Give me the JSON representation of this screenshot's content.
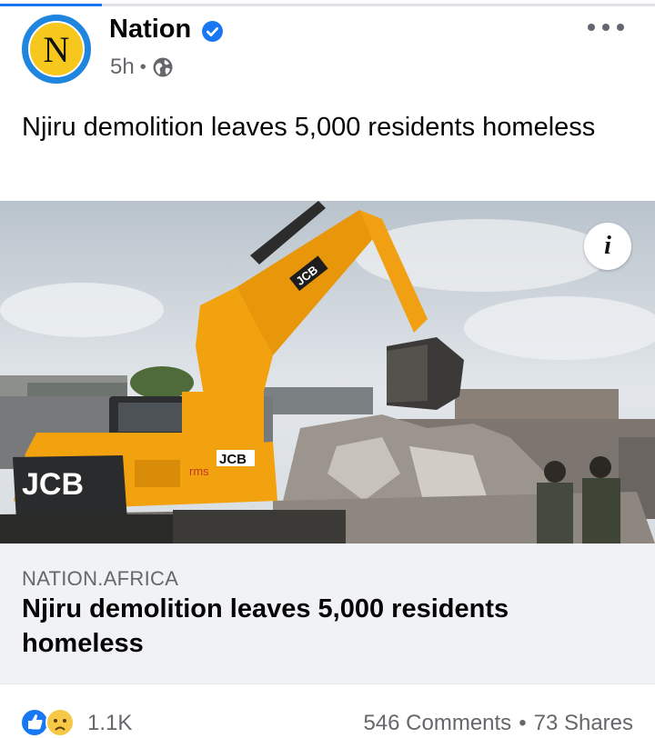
{
  "post": {
    "page_name": "Nation",
    "avatar_letter": "N",
    "timestamp": "5h",
    "separator": "•",
    "caption": "Njiru demolition leaves 5,000 residents homeless",
    "verified_icon": "verified-badge-icon",
    "privacy_icon": "globe-icon",
    "more_icon": "more-options-icon"
  },
  "media": {
    "info_label": "i",
    "excavator_brand": "JCB",
    "excavator_logo": "rms"
  },
  "link_preview": {
    "domain": "NATION.AFRICA",
    "title": "Njiru demolition leaves 5,000 residents homeless"
  },
  "stats": {
    "reaction_icons": [
      "like-icon",
      "sad-icon"
    ],
    "reaction_count": "1.1K",
    "comments": "546 Comments",
    "separator": "•",
    "shares": "73 Shares"
  },
  "colors": {
    "accent": "#1877f2",
    "avatar_ring": "#1f86e0",
    "avatar_fill": "#f6c71d",
    "excavator": "#f2a10f",
    "link_card_bg": "#f0f2f5",
    "secondary_text": "#65676b"
  }
}
